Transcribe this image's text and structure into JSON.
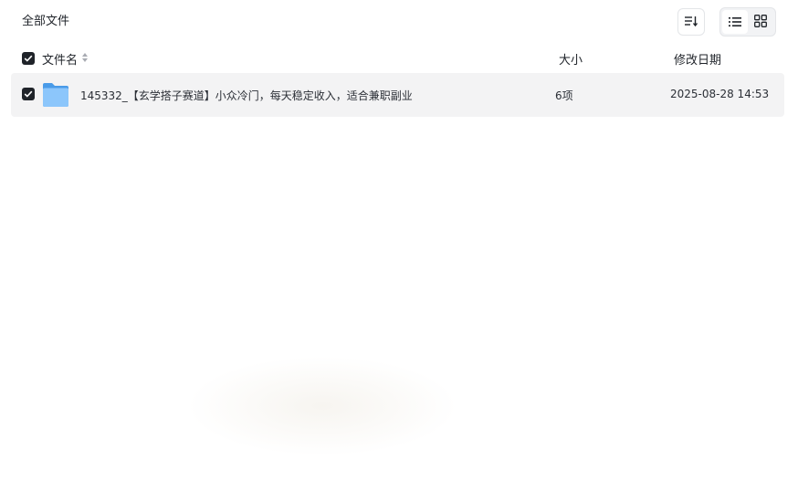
{
  "header": {
    "breadcrumb": "全部文件"
  },
  "toolbar": {
    "sort_icon": "sort-icon",
    "list_view_icon": "list-view-icon",
    "grid_view_icon": "grid-view-icon",
    "active_view": "list"
  },
  "table": {
    "columns": {
      "name": "文件名",
      "size": "大小",
      "date": "修改日期"
    },
    "rows": [
      {
        "icon": "folder-icon",
        "name": "145332_【玄学搭子赛道】小众冷门，每天稳定收入，适合兼职副业",
        "size": "6项",
        "date": "2025-08-28 14:53",
        "checked": true
      }
    ]
  },
  "colors": {
    "row_bg": "#f3f3f4",
    "checkbox": "#1f2329",
    "folder": "#5aa7f0"
  }
}
